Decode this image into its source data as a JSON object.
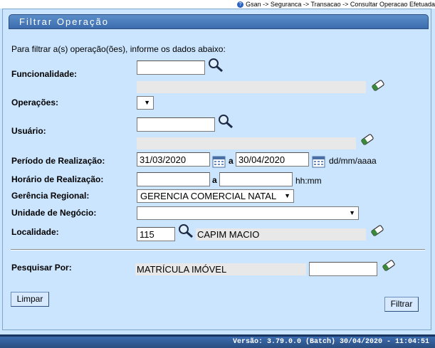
{
  "breadcrumb": "Gsan -> Seguranca -> Transacao -> Consultar Operacao Efetuada",
  "title": "Filtrar Operação",
  "intro": "Para filtrar a(s) operação(ões), informe os dados abaixo:",
  "labels": {
    "funcionalidade": "Funcionalidade:",
    "operacoes": "Operações:",
    "usuario": "Usuário:",
    "periodo": "Período de Realização:",
    "horario": "Horário de Realização:",
    "gerencia": "Gerência Regional:",
    "unidade": "Unidade de Negócio:",
    "localidade": "Localidade:",
    "pesquisar": "Pesquisar Por:"
  },
  "fields": {
    "funcionalidade_code": "",
    "funcionalidade_desc": "",
    "operacoes_selected": "",
    "usuario_code": "",
    "usuario_desc": "",
    "periodo_inicio": "31/03/2020",
    "periodo_fim": "30/04/2020",
    "periodo_separator": "a",
    "date_format_hint": "dd/mm/aaaa",
    "horario_inicio": "",
    "horario_fim": "",
    "horario_separator": "a",
    "time_format_hint": "hh:mm",
    "gerencia_selected": "GERENCIA COMERCIAL NATAL",
    "unidade_selected": "",
    "localidade_code": "115",
    "localidade_desc": "CAPIM MACIO",
    "pesquisar_tipo": "MATRÍCULA IMÓVEL",
    "pesquisar_valor": ""
  },
  "buttons": {
    "limpar": "Limpar",
    "filtrar": "Filtrar"
  },
  "footer": "Versão: 3.79.0.0 (Batch) 30/04/2020 - 11:04:51",
  "icons": {
    "search": "magnifier-icon",
    "eraser": "eraser-icon",
    "calendar": "calendar-icon",
    "help": "help-icon"
  }
}
